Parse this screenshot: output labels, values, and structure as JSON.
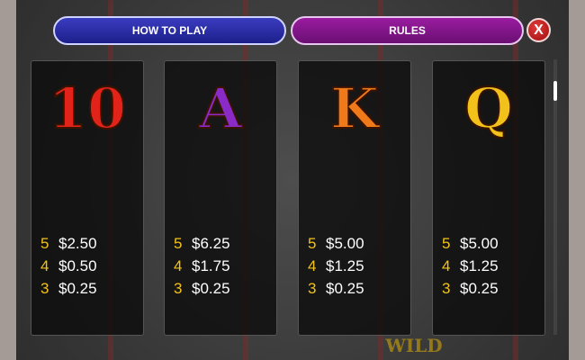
{
  "header": {
    "how_to_play_label": "HOW TO PLAY",
    "rules_label": "RULES",
    "close_label": "X"
  },
  "paytable": [
    {
      "symbol": "10",
      "pays": [
        {
          "count": "5",
          "value": "$2.50"
        },
        {
          "count": "4",
          "value": "$0.50"
        },
        {
          "count": "3",
          "value": "$0.25"
        }
      ]
    },
    {
      "symbol": "A",
      "pays": [
        {
          "count": "5",
          "value": "$6.25"
        },
        {
          "count": "4",
          "value": "$1.75"
        },
        {
          "count": "3",
          "value": "$0.25"
        }
      ]
    },
    {
      "symbol": "K",
      "pays": [
        {
          "count": "5",
          "value": "$5.00"
        },
        {
          "count": "4",
          "value": "$1.25"
        },
        {
          "count": "3",
          "value": "$0.25"
        }
      ]
    },
    {
      "symbol": "Q",
      "pays": [
        {
          "count": "5",
          "value": "$5.00"
        },
        {
          "count": "4",
          "value": "$1.25"
        },
        {
          "count": "3",
          "value": "$0.25"
        }
      ]
    }
  ],
  "background": {
    "wild_text": "WILD"
  },
  "colors": {
    "how_to_play_bg": "#1c1f8a",
    "rules_bg": "#6a0f72",
    "close_bg": "#a10d0d",
    "count_color": "#f2c21a",
    "value_color": "#ffffff"
  }
}
